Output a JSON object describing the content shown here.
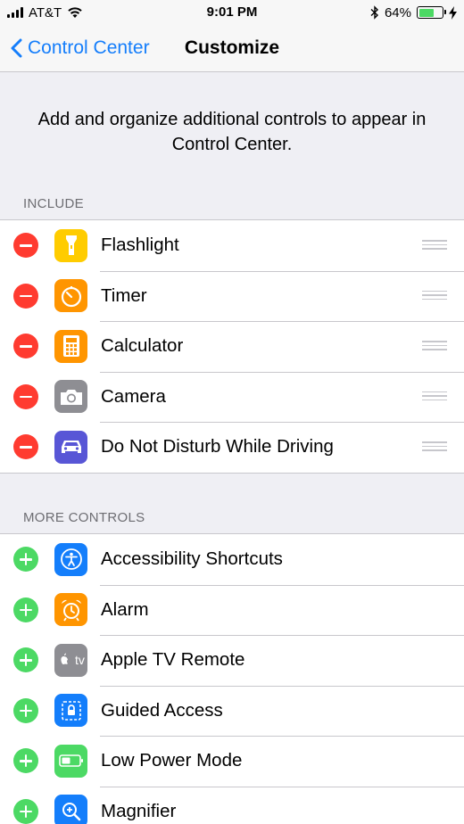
{
  "status_bar": {
    "carrier": "AT&T",
    "time": "9:01 PM",
    "battery_percent": "64%",
    "battery_level": 0.64
  },
  "nav": {
    "back_label": "Control Center",
    "title": "Customize"
  },
  "description": "Add and organize additional controls to appear in Control Center.",
  "include": {
    "header": "INCLUDE",
    "items": [
      {
        "label": "Flashlight",
        "icon": "flashlight-icon",
        "color": "#ffcc00"
      },
      {
        "label": "Timer",
        "icon": "timer-icon",
        "color": "#ff9500"
      },
      {
        "label": "Calculator",
        "icon": "calculator-icon",
        "color": "#ff9500"
      },
      {
        "label": "Camera",
        "icon": "camera-icon",
        "color": "#8e8e93"
      },
      {
        "label": "Do Not Disturb While Driving",
        "icon": "car-icon",
        "color": "#5856d6"
      }
    ]
  },
  "more_controls": {
    "header": "MORE CONTROLS",
    "items": [
      {
        "label": "Accessibility Shortcuts",
        "icon": "accessibility-icon",
        "color": "#147efb"
      },
      {
        "label": "Alarm",
        "icon": "alarm-icon",
        "color": "#ff9500"
      },
      {
        "label": "Apple TV Remote",
        "icon": "apple-tv-icon",
        "icon_text": "tv",
        "color": "#8e8e93"
      },
      {
        "label": "Guided Access",
        "icon": "guided-access-icon",
        "color": "#147efb"
      },
      {
        "label": "Low Power Mode",
        "icon": "battery-icon",
        "color": "#4cd964"
      },
      {
        "label": "Magnifier",
        "icon": "magnifier-icon",
        "color": "#147efb"
      }
    ]
  },
  "colors": {
    "accent": "#157efb",
    "remove": "#ff3b30",
    "add": "#4cd964"
  }
}
